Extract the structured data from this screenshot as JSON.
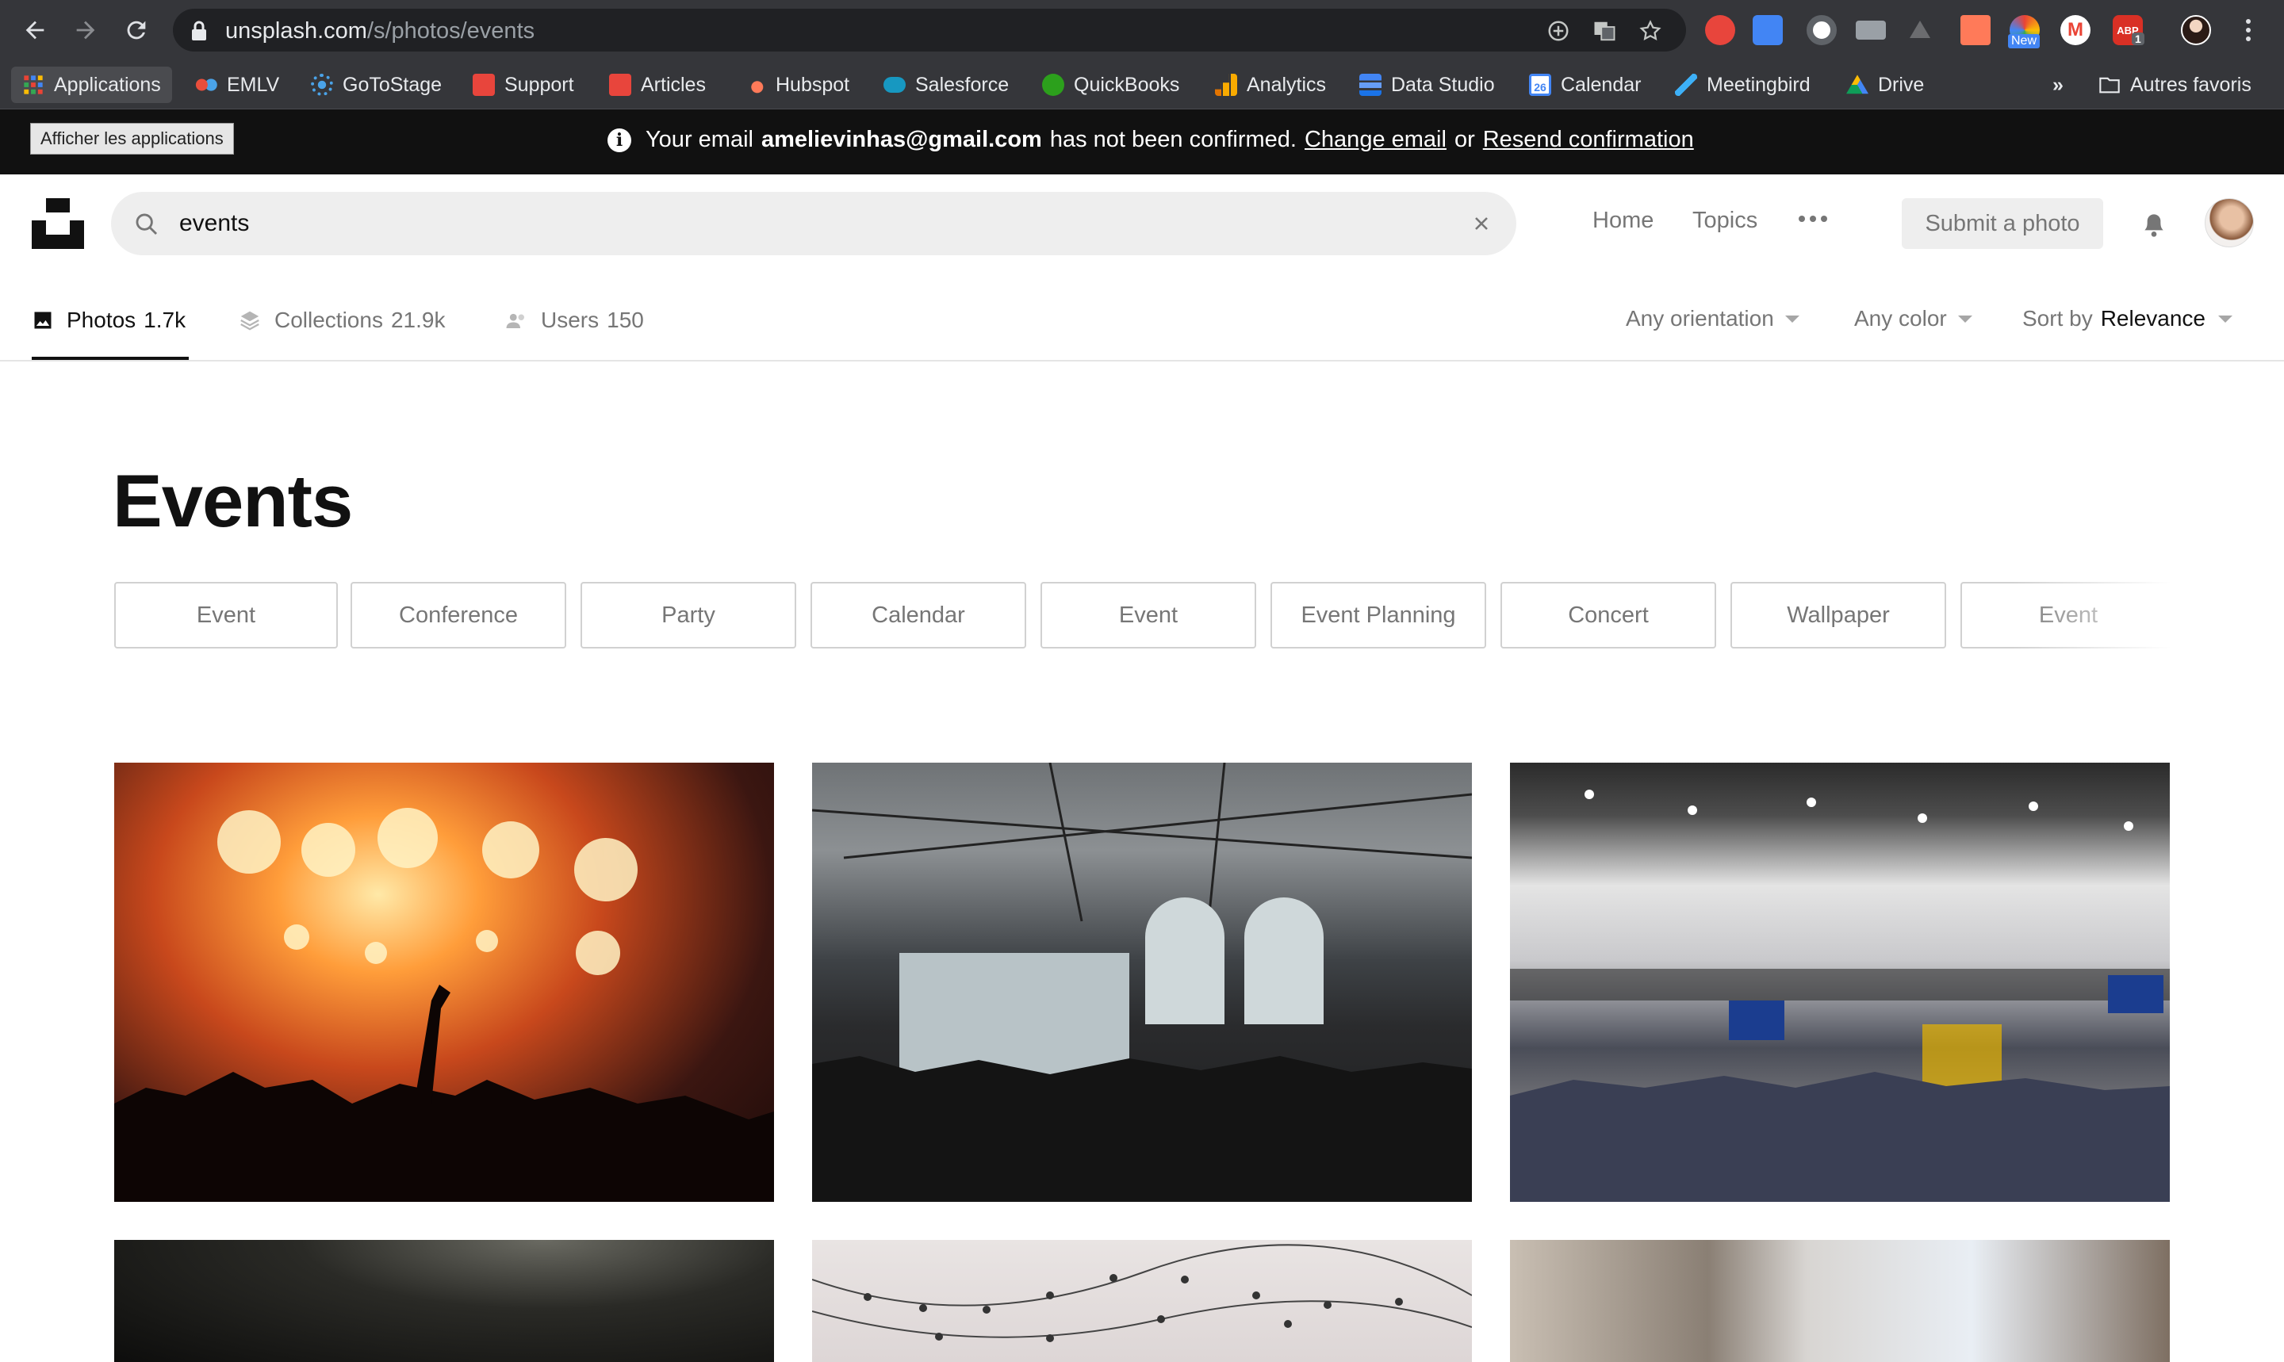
{
  "browser": {
    "url_host": "unsplash.com",
    "url_path": "/s/photos/events",
    "bookmarks": [
      {
        "label": "Applications",
        "icon": "apps-grid-icon",
        "color": "#f4b400"
      },
      {
        "label": "EMLV",
        "icon": "emlv-icon",
        "color": "#e94e3c"
      },
      {
        "label": "GoToStage",
        "icon": "gotostage-icon",
        "color": "#4aa3e8"
      },
      {
        "label": "Support",
        "icon": "support-icon",
        "color": "#e8453c"
      },
      {
        "label": "Articles",
        "icon": "articles-icon",
        "color": "#e8453c"
      },
      {
        "label": "Hubspot",
        "icon": "hubspot-icon",
        "color": "#ff7a59"
      },
      {
        "label": "Salesforce",
        "icon": "salesforce-icon",
        "color": "#1798c1"
      },
      {
        "label": "QuickBooks",
        "icon": "quickbooks-icon",
        "color": "#2ca01c"
      },
      {
        "label": "Analytics",
        "icon": "analytics-icon",
        "color": "#f9ab00"
      },
      {
        "label": "Data Studio",
        "icon": "data-studio-icon",
        "color": "#4285f4"
      },
      {
        "label": "Calendar",
        "icon": "calendar-icon",
        "color": "#4285f4"
      },
      {
        "label": "Meetingbird",
        "icon": "meetingbird-icon",
        "color": "#3db0f7"
      },
      {
        "label": "Drive",
        "icon": "drive-icon",
        "color": "#0f9d58"
      }
    ],
    "overflow_label": "»",
    "other_bookmarks": "Autres favoris",
    "ext_new_badge": "New",
    "ext_abp_label": "ABP",
    "ext_abp_count": "1",
    "ext_m_label": "M"
  },
  "notice": {
    "tooltip": "Afficher les applications",
    "prefix": "Your email",
    "email": "amelievinhas@gmail.com",
    "middle": "has not been confirmed.",
    "change_link": "Change email",
    "or": "or",
    "resend_link": "Resend confirmation"
  },
  "header": {
    "search_value": "events",
    "nav_home": "Home",
    "nav_topics": "Topics",
    "submit": "Submit a photo"
  },
  "subnav": {
    "tabs": [
      {
        "label": "Photos",
        "count": "1.7k",
        "icon": "photo-icon"
      },
      {
        "label": "Collections",
        "count": "21.9k",
        "icon": "collections-icon"
      },
      {
        "label": "Users",
        "count": "150",
        "icon": "users-icon"
      }
    ],
    "orientation": "Any orientation",
    "color": "Any color",
    "sort_prefix": "Sort by",
    "sort_value": "Relevance"
  },
  "page": {
    "title": "Events",
    "chips": [
      "Event",
      "Conference",
      "Party",
      "Calendar",
      "Event",
      "Event Planning",
      "Concert",
      "Wallpaper",
      "Event"
    ]
  }
}
